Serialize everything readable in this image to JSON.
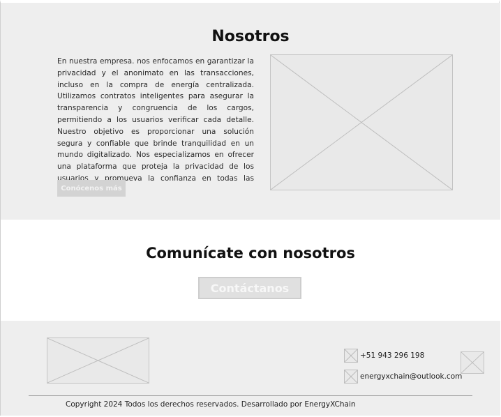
{
  "about": {
    "title": "Nosotros",
    "paragraph": "En nuestra empresa. nos enfocamos en garantizar la privacidad y el anonimato en las transacciones, incluso en la compra de energía centralizada. Utilizamos contratos inteligentes para asegurar la transparencia y congruencia de los cargos, permitiendo a los usuarios verificar cada detalle. Nuestro objetivo es proporcionar una solución segura y confiable que brinde tranquilidad en un mundo digitalizado. Nos especializamos en ofrecer una plataforma que proteja la privacidad de los usuarios y promueva la confianza en todas las transacciones.",
    "button_label": "Conócenos más",
    "image_icon": "image-placeholder-icon"
  },
  "contact": {
    "title": "Comunícate con nosotros",
    "button_label": "Contáctanos"
  },
  "footer": {
    "logo_icon": "logo-placeholder-icon",
    "phone": "+51 943 296 198",
    "phone_icon": "phone-placeholder-icon",
    "email": "energyxchain@outlook.com",
    "email_icon": "email-placeholder-icon",
    "social_icon": "social-placeholder-icon",
    "copyright": "Copyright 2024 Todos los derechos reservados. Desarrollado por EnergyXChain"
  },
  "colors": {
    "section_bg": "#eeeeee",
    "button_bg": "#d3d3d3",
    "placeholder_bg": "#e9e9e9"
  }
}
